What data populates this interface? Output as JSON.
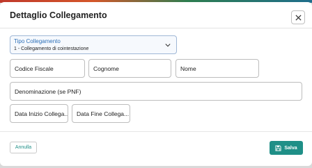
{
  "dialog": {
    "title": "Dettaglio Collegamento"
  },
  "tipo_collegamento": {
    "label": "Tipo Collegamento",
    "value": "1 - Collegamento di cointestazione"
  },
  "fields": {
    "codice_fiscale": "Codice Fiscale",
    "cognome": "Cognome",
    "nome": "Nome",
    "denominazione": "Denominazione (se PNF)",
    "data_inizio": "Data Inizio Collega...",
    "data_fine": "Data Fine Collega..."
  },
  "footer": {
    "cancel_label": "Annulla",
    "save_label": "Salva"
  },
  "icons": {
    "close": "close-icon",
    "chevron": "chevron-down-icon",
    "save": "floppy-disk-icon"
  },
  "colors": {
    "accent": "#1f8f87",
    "select_border": "#9fb7d6",
    "select_label": "#2c6fb7"
  }
}
